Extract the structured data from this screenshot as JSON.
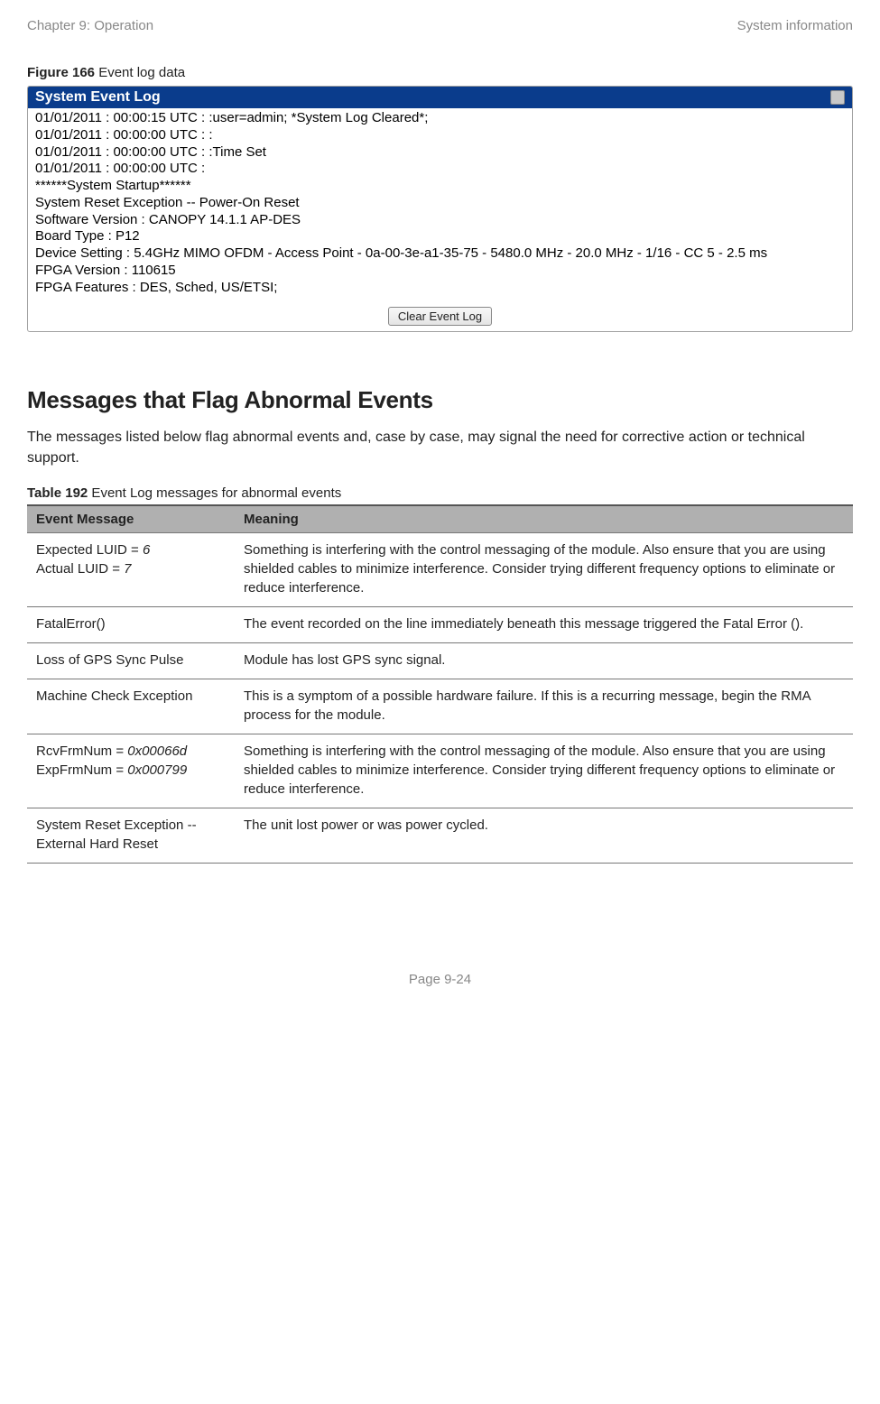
{
  "header": {
    "left": "Chapter 9:  Operation",
    "right": "System information"
  },
  "figure": {
    "label_bold": "Figure 166",
    "label_rest": " Event log data",
    "titlebar": "System Event Log",
    "lines": [
      "01/01/2011 : 00:00:15 UTC : :user=admin; *System Log Cleared*;",
      "01/01/2011 : 00:00:00 UTC : :",
      "01/01/2011 : 00:00:00 UTC : :Time Set",
      "01/01/2011 : 00:00:00 UTC :",
      "******System Startup******",
      "System Reset Exception -- Power-On Reset",
      "Software Version : CANOPY 14.1.1 AP-DES",
      "Board Type : P12",
      "Device Setting : 5.4GHz MIMO OFDM - Access Point - 0a-00-3e-a1-35-75 - 5480.0 MHz - 20.0 MHz - 1/16 - CC 5 - 2.5 ms",
      "FPGA Version : 110615",
      "FPGA Features : DES, Sched, US/ETSI;"
    ],
    "button": "Clear Event Log"
  },
  "section": {
    "heading": "Messages that Flag Abnormal Events",
    "body": "The messages listed below flag abnormal events and, case by case, may signal the need for corrective action or technical support."
  },
  "table": {
    "caption_bold": "Table 192",
    "caption_rest": " Event Log messages for abnormal events",
    "headers": {
      "col1": "Event Message",
      "col2": "Meaning"
    },
    "rows": [
      {
        "msg_pre1": "Expected LUID = ",
        "msg_it1": "6",
        "msg_pre2": "Actual LUID = ",
        "msg_it2": "7",
        "meaning": "Something is interfering with the control messaging of the module. Also ensure that you are using shielded cables to minimize interference. Consider trying different frequency options to eliminate or reduce interference."
      },
      {
        "msg": "FatalError()",
        "meaning": "The event recorded on the line immediately beneath this message triggered the Fatal Error ()."
      },
      {
        "msg": "Loss of GPS Sync Pulse",
        "meaning": "Module has lost GPS sync signal."
      },
      {
        "msg": "Machine Check Exception",
        "meaning": "This is a symptom of a possible hardware failure. If this is a recurring message, begin the RMA process for the module."
      },
      {
        "msg_pre1": "RcvFrmNum = ",
        "msg_it1": "0x00066d",
        "msg_pre2": "ExpFrmNum = ",
        "msg_it2": "0x000799",
        "meaning": "Something is interfering with the control messaging of the module. Also ensure that you are using shielded cables to minimize interference. Consider trying different frequency options to eliminate or reduce interference."
      },
      {
        "msg": "System Reset Exception -- External Hard Reset",
        "meaning": "The unit lost power or was power cycled."
      }
    ]
  },
  "footer": {
    "page": "Page 9-24"
  }
}
